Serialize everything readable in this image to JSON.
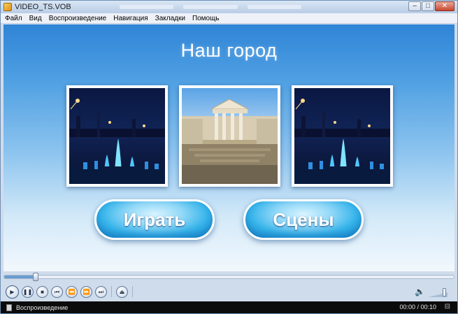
{
  "window": {
    "title": "VIDEO_TS.VOB"
  },
  "menu": [
    "Файл",
    "Вид",
    "Воспроизведение",
    "Навигация",
    "Закладки",
    "Помощь"
  ],
  "dvd_menu": {
    "title": "Наш город",
    "thumbnails": [
      "night-fountain-icon",
      "building-icon",
      "night-fountain-icon"
    ],
    "buttons": [
      "Играть",
      "Сцены"
    ]
  },
  "player": {
    "progress": 0.07,
    "controls": [
      "play-icon",
      "pause-icon",
      "stop-icon",
      "prev-icon",
      "rewind-icon",
      "forward-icon",
      "next-icon",
      "eject-icon"
    ],
    "volume_level": 0.8
  },
  "status": {
    "text": "Воспроизведение",
    "time": "00:00 / 00:10"
  },
  "colors": {
    "accent": "#2f84d6",
    "button": "#36b4ea",
    "statusbar": "#0b0b0b"
  }
}
